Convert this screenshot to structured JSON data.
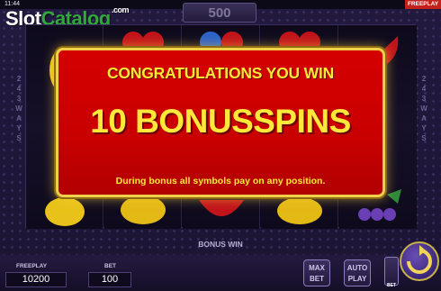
{
  "status": {
    "time": "11:44",
    "mode_tag": "FREEPLAY"
  },
  "top_win": "500",
  "logo": {
    "part1": "Slot",
    "part2": "Catalog",
    "suffix": ".com"
  },
  "ways": {
    "left": [
      "2",
      "4",
      "3",
      "W",
      "A",
      "Y",
      "S"
    ],
    "right": [
      "2",
      "4",
      "3",
      "W",
      "A",
      "Y",
      "S"
    ]
  },
  "popup": {
    "title": "CONGRATULATIONS YOU WIN",
    "headline": "10 BONUSSPINS",
    "note": "During bonus all symbols pay on any position."
  },
  "bonus_win_label": "BONUS WIN",
  "freeplay": {
    "label": "FREEPLAY",
    "value": "10200"
  },
  "bet": {
    "label": "BET",
    "value": "100"
  },
  "buttons": {
    "max_bet": [
      "MAX",
      "BET"
    ],
    "auto_play": [
      "AUTO",
      "PLAY"
    ],
    "bet_mini": "BET"
  },
  "colors": {
    "popup_red": "#c90000",
    "popup_text": "#ffe83a",
    "frame_gold": "#f0d04a"
  }
}
